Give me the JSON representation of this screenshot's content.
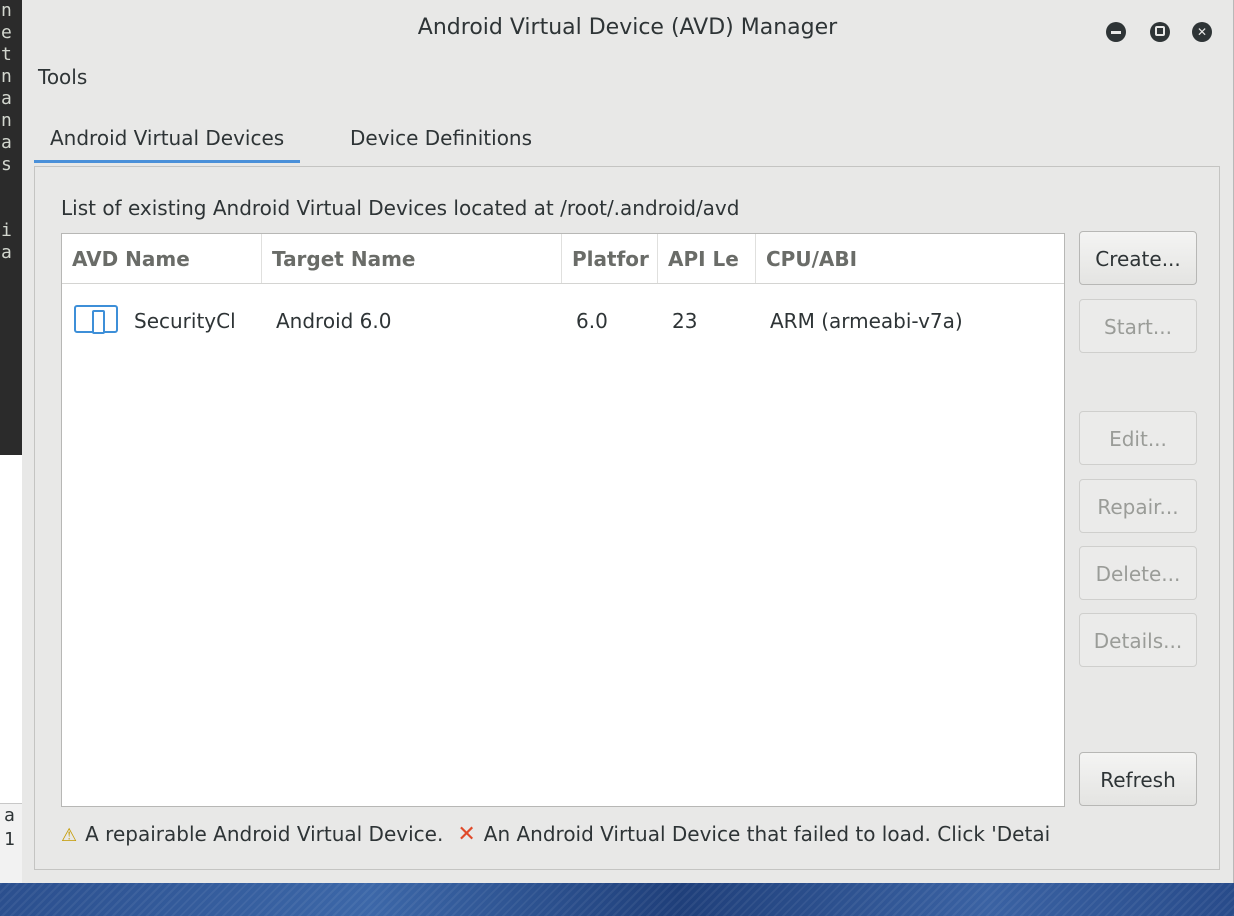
{
  "window": {
    "title": "Android Virtual Device (AVD) Manager"
  },
  "menu": {
    "tools": "Tools"
  },
  "tabs": [
    {
      "label": "Android Virtual Devices",
      "active": true
    },
    {
      "label": "Device Definitions",
      "active": false
    }
  ],
  "avd_panel": {
    "path_label": "List of existing Android Virtual Devices located at /root/.android/avd",
    "columns": [
      "AVD Name",
      "Target Name",
      "Platfor",
      "API Le",
      "CPU/ABI"
    ],
    "rows": [
      {
        "icon": "device-icon",
        "avd_name": "SecurityCl",
        "target_name": "Android 6.0",
        "platform": "6.0",
        "api_level": "23",
        "cpu_abi": "ARM (armeabi-v7a)"
      }
    ]
  },
  "buttons": {
    "create": "Create...",
    "start": "Start...",
    "edit": "Edit...",
    "repair": "Repair...",
    "delete": "Delete...",
    "details": "Details...",
    "refresh": "Refresh"
  },
  "legend": {
    "repairable": "A repairable Android Virtual Device.",
    "failed": "An Android Virtual Device that failed to load. Click 'Detai"
  },
  "background": {
    "terminal_lines": [
      "n",
      "e",
      "t",
      "n",
      "a",
      "n",
      "a",
      "s",
      "",
      "",
      "i",
      "a"
    ],
    "lower_lines": [
      "a",
      "1"
    ]
  },
  "colors": {
    "accent": "#4a90d9",
    "warning": "#c49a00",
    "error": "#e04a2a"
  }
}
